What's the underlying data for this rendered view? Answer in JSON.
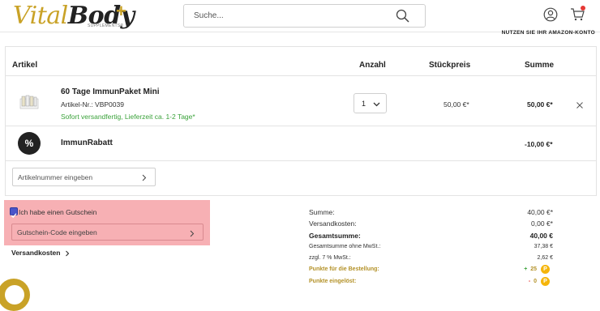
{
  "header": {
    "logo": {
      "part1": "Vital",
      "part2": "Body",
      "plus": "+",
      "sub": "SUPPLEMENTS®"
    },
    "search_placeholder": "Suche...",
    "amazon_text": "NUTZEN SIE IHR AMAZON-KONTO"
  },
  "cart": {
    "columns": {
      "article": "Artikel",
      "qty": "Anzahl",
      "unit_price": "Stückpreis",
      "total": "Summe"
    },
    "item": {
      "name": "60 Tage ImmunPaket Mini",
      "sku": "Artikel-Nr.: VBP0039",
      "shipping": "Sofort versandfertig, Lieferzeit ca. 1-2 Tage*",
      "qty": "1",
      "unit_price": "50,00 €*",
      "total": "50,00 €*"
    },
    "rebate": {
      "symbol": "%",
      "name": "ImmunRabatt",
      "value": "-10,00 €*"
    },
    "article_number_placeholder": "Artikelnummer eingeben"
  },
  "voucher": {
    "checkbox_label": "Ich habe einen Gutschein",
    "code_placeholder": "Gutschein-Code eingeben",
    "checked": true
  },
  "shipping_link": "Versandkosten",
  "summary": {
    "sum_label": "Summe:",
    "sum_value": "40,00 €*",
    "shipping_label": "Versandkosten:",
    "shipping_value": "0,00 €*",
    "total_label": "Gesamtsumme:",
    "total_value": "40,00 €",
    "net_label": "Gesamtsumme ohne MwSt.:",
    "net_value": "37,38 €",
    "vat_label": "zzgl. 7 % MwSt.:",
    "vat_value": "2,62 €",
    "points_order_label": "Punkte für die Bestellung:",
    "points_order_sign": "+",
    "points_order_value": "25",
    "points_redeemed_label": "Punkte eingelöst:",
    "points_redeemed_sign": "-",
    "points_redeemed_value": "0",
    "coin_symbol": "P"
  },
  "colors": {
    "brand": "#c9a227",
    "green": "#3aa23a",
    "coin": "#f5b50a",
    "highlight": "#f7b0b4"
  }
}
